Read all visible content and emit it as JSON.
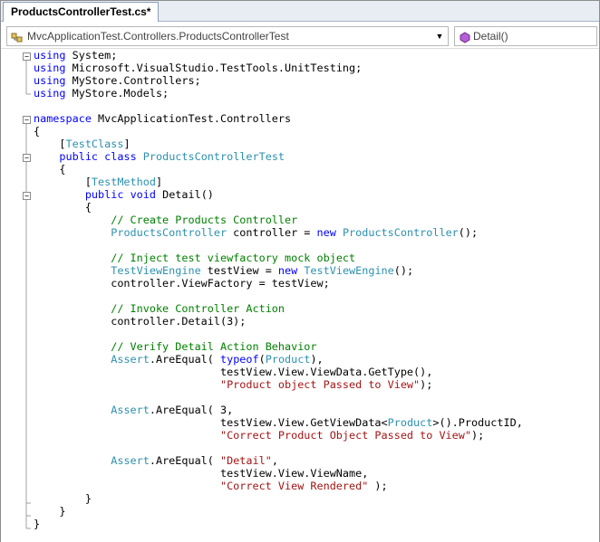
{
  "tab": {
    "title": "ProductsControllerTest.cs*"
  },
  "navigation": {
    "class_selector": "MvcApplicationTest.Controllers.ProductsControllerTest",
    "member_selector": "Detail()"
  },
  "colors": {
    "keyword": "#0000ff",
    "type": "#2b91af",
    "comment": "#008000",
    "string": "#a31515"
  },
  "code_lines": [
    [
      {
        "t": "kw",
        "v": "using"
      },
      {
        "t": "tx",
        "v": " System;"
      }
    ],
    [
      {
        "t": "kw",
        "v": "using"
      },
      {
        "t": "tx",
        "v": " Microsoft.VisualStudio.TestTools.UnitTesting;"
      }
    ],
    [
      {
        "t": "kw",
        "v": "using"
      },
      {
        "t": "tx",
        "v": " MyStore.Controllers;"
      }
    ],
    [
      {
        "t": "kw",
        "v": "using"
      },
      {
        "t": "tx",
        "v": " MyStore.Models;"
      }
    ],
    [],
    [
      {
        "t": "kw",
        "v": "namespace"
      },
      {
        "t": "tx",
        "v": " MvcApplicationTest.Controllers"
      }
    ],
    [
      {
        "t": "tx",
        "v": "{"
      }
    ],
    [
      {
        "t": "tx",
        "v": "    ["
      },
      {
        "t": "ty",
        "v": "TestClass"
      },
      {
        "t": "tx",
        "v": "]"
      }
    ],
    [
      {
        "t": "tx",
        "v": "    "
      },
      {
        "t": "kw",
        "v": "public"
      },
      {
        "t": "tx",
        "v": " "
      },
      {
        "t": "kw",
        "v": "class"
      },
      {
        "t": "tx",
        "v": " "
      },
      {
        "t": "ty",
        "v": "ProductsControllerTest"
      }
    ],
    [
      {
        "t": "tx",
        "v": "    {"
      }
    ],
    [
      {
        "t": "tx",
        "v": "        ["
      },
      {
        "t": "ty",
        "v": "TestMethod"
      },
      {
        "t": "tx",
        "v": "]"
      }
    ],
    [
      {
        "t": "tx",
        "v": "        "
      },
      {
        "t": "kw",
        "v": "public"
      },
      {
        "t": "tx",
        "v": " "
      },
      {
        "t": "kw",
        "v": "void"
      },
      {
        "t": "tx",
        "v": " Detail()"
      }
    ],
    [
      {
        "t": "tx",
        "v": "        {"
      }
    ],
    [
      {
        "t": "tx",
        "v": "            "
      },
      {
        "t": "cm",
        "v": "// Create Products Controller"
      }
    ],
    [
      {
        "t": "tx",
        "v": "            "
      },
      {
        "t": "ty",
        "v": "ProductsController"
      },
      {
        "t": "tx",
        "v": " controller = "
      },
      {
        "t": "kw",
        "v": "new"
      },
      {
        "t": "tx",
        "v": " "
      },
      {
        "t": "ty",
        "v": "ProductsController"
      },
      {
        "t": "tx",
        "v": "();"
      }
    ],
    [],
    [
      {
        "t": "tx",
        "v": "            "
      },
      {
        "t": "cm",
        "v": "// Inject test viewfactory mock object"
      }
    ],
    [
      {
        "t": "tx",
        "v": "            "
      },
      {
        "t": "ty",
        "v": "TestViewEngine"
      },
      {
        "t": "tx",
        "v": " testView = "
      },
      {
        "t": "kw",
        "v": "new"
      },
      {
        "t": "tx",
        "v": " "
      },
      {
        "t": "ty",
        "v": "TestViewEngine"
      },
      {
        "t": "tx",
        "v": "();"
      }
    ],
    [
      {
        "t": "tx",
        "v": "            controller.ViewFactory = testView;"
      }
    ],
    [],
    [
      {
        "t": "tx",
        "v": "            "
      },
      {
        "t": "cm",
        "v": "// Invoke Controller Action"
      }
    ],
    [
      {
        "t": "tx",
        "v": "            controller.Detail(3);"
      }
    ],
    [],
    [
      {
        "t": "tx",
        "v": "            "
      },
      {
        "t": "cm",
        "v": "// Verify Detail Action Behavior"
      }
    ],
    [
      {
        "t": "tx",
        "v": "            "
      },
      {
        "t": "ty",
        "v": "Assert"
      },
      {
        "t": "tx",
        "v": ".AreEqual( "
      },
      {
        "t": "kw",
        "v": "typeof"
      },
      {
        "t": "tx",
        "v": "("
      },
      {
        "t": "ty",
        "v": "Product"
      },
      {
        "t": "tx",
        "v": "),"
      }
    ],
    [
      {
        "t": "tx",
        "v": "                             testView.View.ViewData.GetType(),"
      }
    ],
    [
      {
        "t": "tx",
        "v": "                             "
      },
      {
        "t": "st",
        "v": "\"Product object Passed to View\""
      },
      {
        "t": "tx",
        "v": ");"
      }
    ],
    [],
    [
      {
        "t": "tx",
        "v": "            "
      },
      {
        "t": "ty",
        "v": "Assert"
      },
      {
        "t": "tx",
        "v": ".AreEqual( 3,"
      }
    ],
    [
      {
        "t": "tx",
        "v": "                             testView.View.GetViewData<"
      },
      {
        "t": "ty",
        "v": "Product"
      },
      {
        "t": "tx",
        "v": ">().ProductID,"
      }
    ],
    [
      {
        "t": "tx",
        "v": "                             "
      },
      {
        "t": "st",
        "v": "\"Correct Product Object Passed to View\""
      },
      {
        "t": "tx",
        "v": ");"
      }
    ],
    [],
    [
      {
        "t": "tx",
        "v": "            "
      },
      {
        "t": "ty",
        "v": "Assert"
      },
      {
        "t": "tx",
        "v": ".AreEqual( "
      },
      {
        "t": "st",
        "v": "\"Detail\""
      },
      {
        "t": "tx",
        "v": ","
      }
    ],
    [
      {
        "t": "tx",
        "v": "                             testView.View.ViewName,"
      }
    ],
    [
      {
        "t": "tx",
        "v": "                             "
      },
      {
        "t": "st",
        "v": "\"Correct View Rendered\""
      },
      {
        "t": "tx",
        "v": " );"
      }
    ],
    [
      {
        "t": "tx",
        "v": "        }"
      }
    ],
    [
      {
        "t": "tx",
        "v": "    }"
      }
    ],
    [
      {
        "t": "tx",
        "v": "}"
      }
    ]
  ]
}
